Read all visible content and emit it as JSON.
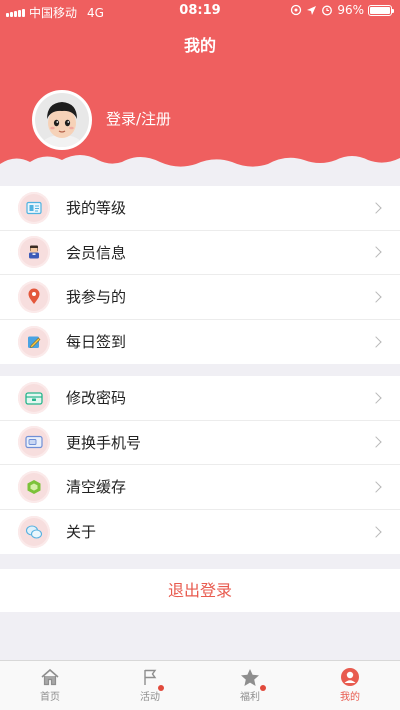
{
  "status_bar": {
    "carrier": "中国移动",
    "network": "4G",
    "time": "08:19",
    "battery": "96%"
  },
  "header": {
    "title": "我的",
    "login_label": "登录/注册"
  },
  "menu_group_1": [
    {
      "label": "我的等级",
      "icon": "level-card-icon"
    },
    {
      "label": "会员信息",
      "icon": "member-icon"
    },
    {
      "label": "我参与的",
      "icon": "location-pin-icon"
    },
    {
      "label": "每日签到",
      "icon": "pencil-checkin-icon"
    }
  ],
  "menu_group_2": [
    {
      "label": "修改密码",
      "icon": "password-icon"
    },
    {
      "label": "更换手机号",
      "icon": "phone-card-icon"
    },
    {
      "label": "清空缓存",
      "icon": "clear-cache-icon"
    },
    {
      "label": "关于",
      "icon": "about-chat-icon"
    }
  ],
  "logout_label": "退出登录",
  "tabbar": [
    {
      "label": "首页",
      "icon": "home-icon",
      "badge": false
    },
    {
      "label": "活动",
      "icon": "flag-icon",
      "badge": true
    },
    {
      "label": "福利",
      "icon": "star-icon",
      "badge": true
    },
    {
      "label": "我的",
      "icon": "profile-icon",
      "badge": false,
      "active": true
    }
  ],
  "colors": {
    "brand": "#ef5f5f",
    "accent_text": "#e85b4f",
    "badge": "#e14a3c"
  }
}
